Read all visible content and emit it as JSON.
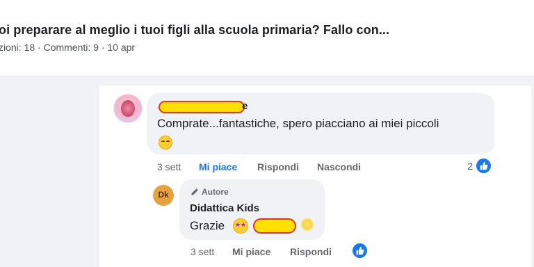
{
  "post": {
    "title": "oi preparare al meglio i tuoi figli alla scuola primaria? Fallo con...",
    "meta": "zioni: 18 · Commenti: 9 · 10 apr"
  },
  "comment1": {
    "author_suffix": "e",
    "text": "Comprate...fantastiche, spero piacciano ai miei piccoli",
    "emoji": "smiling-face-with-smiling-eyes",
    "time": "3 sett",
    "like_label": "Mi piace",
    "reply_label": "Rispondi",
    "hide_label": "Nascondi",
    "like_count": "2"
  },
  "reply": {
    "badge": "Autore",
    "author": "Didattica Kids",
    "avatar_text": "Dk",
    "text": "Grazie",
    "emojis": [
      "star-struck-face",
      "sun"
    ],
    "time": "3 sett",
    "like_label": "Mi piace",
    "reply_label": "Rispondi"
  },
  "colors": {
    "accent": "#1877f2",
    "bubble": "#f0f2f5",
    "redaction_fill": "#ffe000",
    "redaction_border": "#e8322f"
  }
}
